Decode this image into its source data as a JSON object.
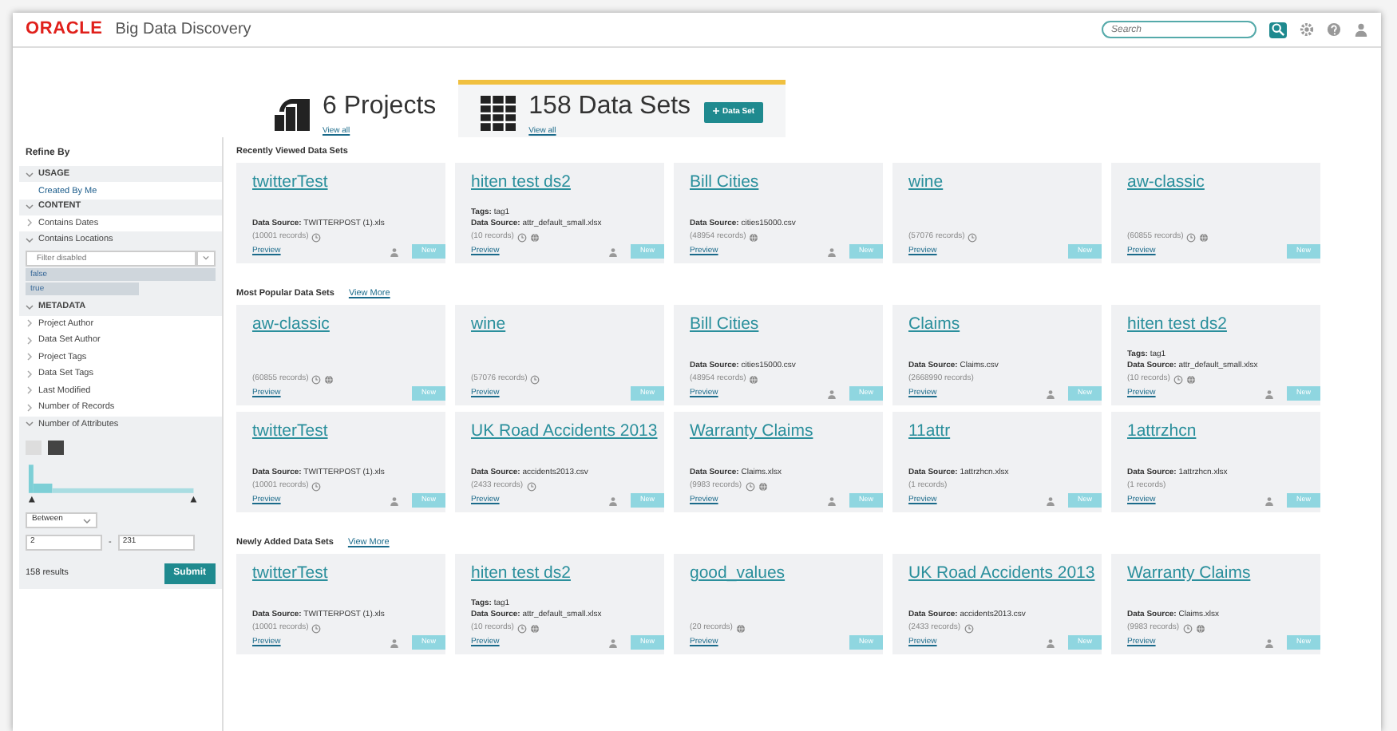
{
  "header": {
    "logo": "ORACLE",
    "product": "Big Data Discovery",
    "search": {
      "placeholder": "Search"
    }
  },
  "tabs": [
    {
      "count": "6 Projects",
      "link": "View all",
      "selected": false,
      "kind": "projects"
    },
    {
      "count": "158 Data Sets",
      "link": "View all",
      "selected": true,
      "kind": "datasets",
      "action": "Data Set"
    }
  ],
  "sidebar": {
    "title": "Refine By",
    "groups": [
      {
        "label": "USAGE",
        "expanded": true,
        "items": [
          {
            "label": "Created By Me",
            "kind": "link"
          }
        ]
      },
      {
        "label": "CONTENT",
        "expanded": true,
        "items": [
          {
            "label": "Contains Dates",
            "kind": "facet",
            "expanded": false
          },
          {
            "label": "Contains Locations",
            "kind": "values",
            "expanded": true,
            "placeholder": "Filter disabled",
            "values": [
              {
                "label": "false",
                "level": 1
              },
              {
                "label": "true",
                "level": 0.6
              }
            ]
          }
        ]
      },
      {
        "label": "METADATA",
        "expanded": true,
        "items": [
          {
            "label": "Project Author",
            "kind": "facet",
            "expanded": false
          },
          {
            "label": "Data Set Author",
            "kind": "facet",
            "expanded": false
          },
          {
            "label": "Project Tags",
            "kind": "facet",
            "expanded": false
          },
          {
            "label": "Data Set Tags",
            "kind": "facet",
            "expanded": false
          },
          {
            "label": "Last Modified",
            "kind": "facet",
            "expanded": false
          },
          {
            "label": "Number of Records",
            "kind": "facet",
            "expanded": false
          },
          {
            "label": "Number of Attributes",
            "kind": "range",
            "expanded": true,
            "operator": "Between",
            "from": "2",
            "dash": "-",
            "to": "231",
            "results": "158 results",
            "submit": "Submit"
          }
        ]
      }
    ]
  },
  "sections": [
    {
      "title": "Recently Viewed Data Sets",
      "rows": [
        [
          {
            "name": "twitterTest",
            "source": "**Data Source:** TWITTERPOST (1).xls",
            "records": "(10001 records)",
            "clock": true,
            "globe": false,
            "owner": true,
            "preview": "Preview",
            "new": "New"
          },
          {
            "name": "hiten test ds2",
            "tags": "**Tags:** tag1",
            "source": "**Data Source:** attr_default_small.xlsx",
            "records": "(10 records)",
            "clock": true,
            "globe": true,
            "owner": true,
            "preview": "Preview",
            "new": "New"
          },
          {
            "name": "Bill Cities",
            "source": "**Data Source:** cities15000.csv",
            "records": "(48954 records)",
            "clock": false,
            "globe": true,
            "owner": true,
            "preview": "Preview",
            "new": "New"
          },
          {
            "name": "wine",
            "records": "(57076 records)",
            "clock": true,
            "globe": false,
            "owner": false,
            "preview": "Preview",
            "new": "New"
          },
          {
            "name": "aw-classic",
            "records": "(60855 records)",
            "clock": true,
            "globe": true,
            "owner": false,
            "preview": "Preview",
            "new": "New"
          }
        ]
      ]
    },
    {
      "title": "Most Popular Data Sets",
      "more": "View More",
      "rows": [
        [
          {
            "name": "aw-classic",
            "records": "(60855 records)",
            "clock": true,
            "globe": true,
            "owner": false,
            "preview": "Preview",
            "new": "New"
          },
          {
            "name": "wine",
            "records": "(57076 records)",
            "clock": true,
            "globe": false,
            "owner": false,
            "preview": "Preview",
            "new": "New"
          },
          {
            "name": "Bill Cities",
            "source": "**Data Source:** cities15000.csv",
            "records": "(48954 records)",
            "clock": false,
            "globe": true,
            "owner": true,
            "preview": "Preview",
            "new": "New"
          },
          {
            "name": "Claims",
            "source": "**Data Source:** Claims.csv",
            "records": "(2668990 records)",
            "clock": false,
            "globe": false,
            "owner": true,
            "preview": "Preview",
            "new": "New"
          },
          {
            "name": "hiten test ds2",
            "tags": "**Tags:** tag1",
            "source": "**Data Source:** attr_default_small.xlsx",
            "records": "(10 records)",
            "clock": true,
            "globe": true,
            "owner": true,
            "preview": "Preview",
            "new": "New"
          }
        ],
        [
          {
            "name": "twitterTest",
            "source": "**Data Source:** TWITTERPOST (1).xls",
            "records": "(10001 records)",
            "clock": true,
            "globe": false,
            "owner": true,
            "preview": "Preview",
            "new": "New"
          },
          {
            "name": "UK Road Accidents 2013",
            "source": "**Data Source:** accidents2013.csv",
            "records": "(2433 records)",
            "clock": true,
            "globe": false,
            "owner": true,
            "preview": "Preview",
            "new": "New"
          },
          {
            "name": "Warranty Claims",
            "source": "**Data Source:** Claims.xlsx",
            "records": "(9983 records)",
            "clock": true,
            "globe": true,
            "owner": true,
            "preview": "Preview",
            "new": "New"
          },
          {
            "name": "11attr",
            "source": "**Data Source:** 1attrzhcn.xlsx",
            "records": "(1 records)",
            "clock": false,
            "globe": false,
            "owner": true,
            "preview": "Preview",
            "new": "New"
          },
          {
            "name": "1attrzhcn",
            "source": "**Data Source:** 1attrzhcn.xlsx",
            "records": "(1 records)",
            "clock": false,
            "globe": false,
            "owner": true,
            "preview": "Preview",
            "new": "New"
          }
        ]
      ]
    },
    {
      "title": "Newly Added Data Sets",
      "more": "View More",
      "rows": [
        [
          {
            "name": "twitterTest",
            "source": "**Data Source:** TWITTERPOST (1).xls",
            "records": "(10001 records)",
            "clock": true,
            "globe": false,
            "owner": true,
            "preview": "Preview",
            "new": "New"
          },
          {
            "name": "hiten test ds2",
            "tags": "**Tags:** tag1",
            "source": "**Data Source:** attr_default_small.xlsx",
            "records": "(10 records)",
            "clock": true,
            "globe": true,
            "owner": true,
            "preview": "Preview",
            "new": "New"
          },
          {
            "name": "good_values",
            "records": "(20 records)",
            "clock": false,
            "globe": true,
            "owner": false,
            "preview": "Preview",
            "new": "New"
          },
          {
            "name": "UK Road Accidents 2013",
            "source": "**Data Source:** accidents2013.csv",
            "records": "(2433 records)",
            "clock": true,
            "globe": false,
            "owner": true,
            "preview": "Preview",
            "new": "New"
          },
          {
            "name": "Warranty Claims",
            "source": "**Data Source:** Claims.xlsx",
            "records": "(9983 records)",
            "clock": true,
            "globe": true,
            "owner": true,
            "preview": "Preview",
            "new": "New"
          }
        ]
      ]
    }
  ]
}
